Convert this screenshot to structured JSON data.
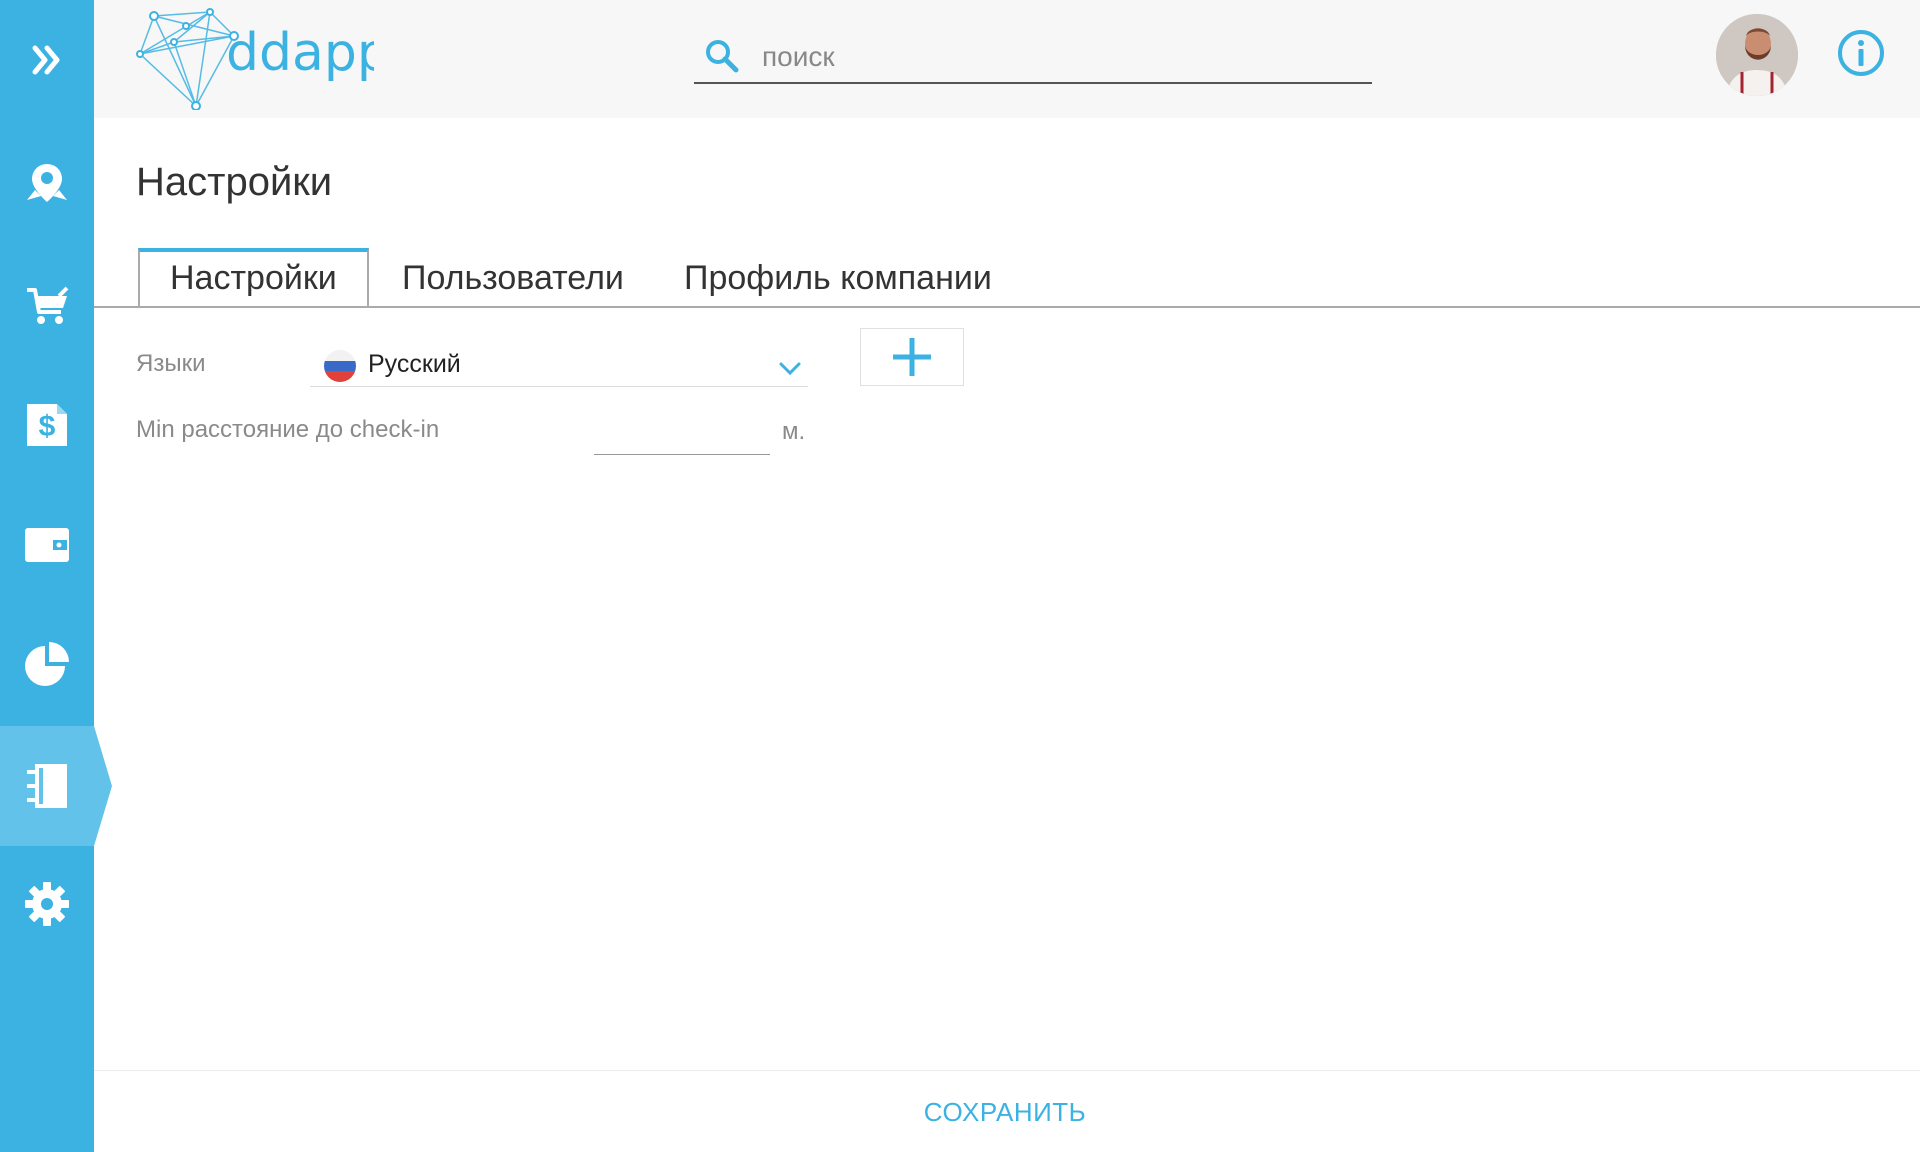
{
  "brand": {
    "name": "ddapp",
    "accent_color": "#3bb2e2"
  },
  "sidebar": {
    "items": [
      {
        "name": "expand",
        "icon": "double-chevron-right-icon"
      },
      {
        "name": "locations",
        "icon": "map-pin-icon"
      },
      {
        "name": "orders",
        "icon": "shopping-cart-icon"
      },
      {
        "name": "invoices",
        "icon": "dollar-document-icon"
      },
      {
        "name": "wallet",
        "icon": "wallet-icon"
      },
      {
        "name": "reports",
        "icon": "pie-chart-icon"
      },
      {
        "name": "documents",
        "icon": "notebook-icon",
        "active": true
      },
      {
        "name": "settings",
        "icon": "gear-icon"
      }
    ]
  },
  "header": {
    "search": {
      "placeholder": "поиск",
      "value": ""
    },
    "avatar_icon": "user-avatar",
    "info_icon": "info-icon"
  },
  "page": {
    "title": "Настройки",
    "tabs": [
      {
        "label": "Настройки",
        "active": true
      },
      {
        "label": "Пользователи",
        "active": false
      },
      {
        "label": "Профиль компании",
        "active": false
      }
    ]
  },
  "settings": {
    "languages_label": "Языки",
    "language_selected": "Русский",
    "add_icon": "plus-icon",
    "min_distance_label": "Min расстояние до check-in",
    "min_distance_value": "",
    "min_distance_unit": "м."
  },
  "footer": {
    "save_label": "СОХРАНИТЬ"
  }
}
